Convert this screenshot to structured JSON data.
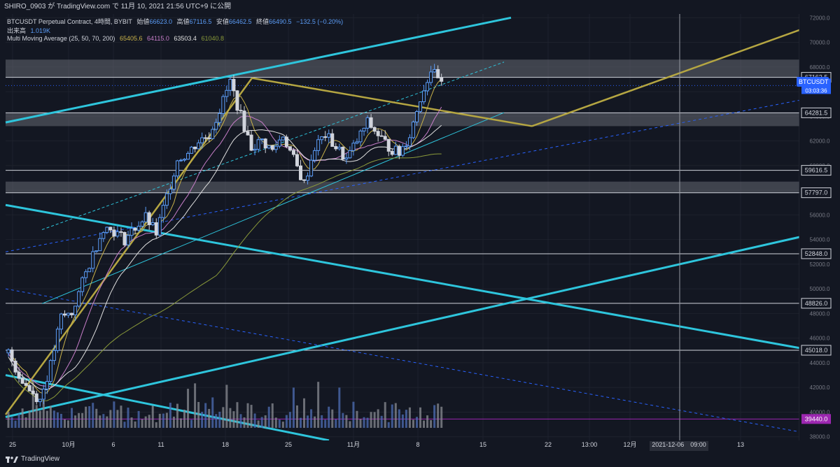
{
  "header": {
    "publish_line": "SHIRO_0903 が TradingView.com で 11月 10, 2021 21:56 UTC+9 に公開"
  },
  "legend": {
    "symbol_line": "BTCUSDT Perpetual Contract, 4時間, BYBIT",
    "open_label": "始値",
    "open_value": "66623.0",
    "high_label": "高値",
    "high_value": "67116.5",
    "low_label": "安値",
    "low_value": "66462.5",
    "close_label": "終値",
    "close_value": "66490.5",
    "change_value": "−132.5 (−0.20%)",
    "volume_label": "出来高",
    "volume_value": "1.019K",
    "ma_label": "Multi Moving Average (25, 50, 70, 200)",
    "ma_values": [
      "65405.6",
      "64115.0",
      "63503.4",
      "61040.8"
    ]
  },
  "colors": {
    "background": "#131722",
    "ma25": "#c9b24a",
    "ma50": "#c77ec9",
    "ma70": "#e0e0e0",
    "ma200": "#8a9a3a",
    "channel": "#2ec5dc",
    "trendline": "#b5a642",
    "price_tag": "#2962ff",
    "vol_tag": "#9c27b0"
  },
  "chart_data": {
    "type": "candlestick",
    "title": "BTCUSDT Perpetual Contract, 4時間, BYBIT",
    "ylim": [
      37700,
      72300
    ],
    "y_ticks": [
      38000,
      40000,
      42000,
      44000,
      46000,
      48000,
      50000,
      52000,
      54000,
      56000,
      58000,
      60000,
      62000,
      64000,
      66000,
      68000,
      70000,
      72000
    ],
    "x_ticks": [
      "25",
      "10月",
      "6",
      "11",
      "18",
      "25",
      "11月",
      "8",
      "15",
      "22",
      "13:00",
      "12月",
      "13"
    ],
    "crosshair_label": "2021-12-06　09:00",
    "price_levels": [
      67162.5,
      64281.5,
      59616.5,
      57797.0,
      52848.0,
      48826.0,
      45018.0
    ],
    "price_level_labels": [
      "67162.5",
      "64281.5",
      "59616.5",
      "57797.0",
      "52848.0",
      "48826.0",
      "45018.0"
    ],
    "current_price": {
      "symbol": "BTCUSDT",
      "price": "66490.5",
      "countdown": "03:03:36"
    },
    "volume_marker": "39440.0",
    "zones": [
      [
        67162.5,
        68600
      ],
      [
        63200,
        64281.5
      ],
      [
        57797.0,
        58700
      ]
    ],
    "close_path": [
      {
        "t": 0,
        "c": 44800
      },
      {
        "t": 3,
        "c": 43000
      },
      {
        "t": 6,
        "c": 41800
      },
      {
        "t": 9,
        "c": 41000
      },
      {
        "t": 12,
        "c": 43800
      },
      {
        "t": 15,
        "c": 47700
      },
      {
        "t": 18,
        "c": 48000
      },
      {
        "t": 21,
        "c": 50500
      },
      {
        "t": 24,
        "c": 52800
      },
      {
        "t": 27,
        "c": 55000
      },
      {
        "t": 30,
        "c": 54700
      },
      {
        "t": 33,
        "c": 54000
      },
      {
        "t": 36,
        "c": 55000
      },
      {
        "t": 39,
        "c": 55800
      },
      {
        "t": 42,
        "c": 54500
      },
      {
        "t": 45,
        "c": 57500
      },
      {
        "t": 48,
        "c": 60500
      },
      {
        "t": 51,
        "c": 61000
      },
      {
        "t": 54,
        "c": 62000
      },
      {
        "t": 57,
        "c": 62500
      },
      {
        "t": 60,
        "c": 64500
      },
      {
        "t": 63,
        "c": 66800
      },
      {
        "t": 66,
        "c": 64000
      },
      {
        "t": 69,
        "c": 61500
      },
      {
        "t": 72,
        "c": 62000
      },
      {
        "t": 75,
        "c": 61200
      },
      {
        "t": 78,
        "c": 62500
      },
      {
        "t": 81,
        "c": 60500
      },
      {
        "t": 84,
        "c": 58500
      },
      {
        "t": 87,
        "c": 61500
      },
      {
        "t": 90,
        "c": 62500
      },
      {
        "t": 93,
        "c": 61500
      },
      {
        "t": 96,
        "c": 60500
      },
      {
        "t": 99,
        "c": 62000
      },
      {
        "t": 102,
        "c": 63500
      },
      {
        "t": 105,
        "c": 62500
      },
      {
        "t": 108,
        "c": 61500
      },
      {
        "t": 111,
        "c": 61000
      },
      {
        "t": 114,
        "c": 62500
      },
      {
        "t": 117,
        "c": 65500
      },
      {
        "t": 120,
        "c": 67800
      },
      {
        "t": 123,
        "c": 66490
      }
    ]
  }
}
